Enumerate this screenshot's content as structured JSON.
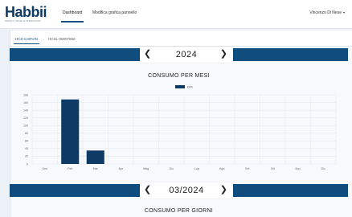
{
  "header": {
    "logo_text": "Habbii",
    "logo_tagline": "SMART HOME EXPERIENCE",
    "nav": [
      {
        "label": "Dashboard"
      },
      {
        "label": "Modifica grafica pannello"
      }
    ],
    "user_name": "Vincenzo Di Nese",
    "user_caret": "▾"
  },
  "tabs": [
    {
      "label": "HCS-CARVIN"
    },
    {
      "label": "HCSL-00007560"
    }
  ],
  "year_selector": {
    "label": "2024",
    "prev": "❮",
    "next": "❯"
  },
  "month_selector": {
    "label": "03/2024",
    "prev": "❮",
    "next": "❯"
  },
  "colors": {
    "bar": "#0e3a66",
    "band": "#0e4d7d"
  },
  "chart_data": {
    "type": "bar",
    "title": "CONSUMO PER MESI",
    "categories": [
      "Gen",
      "Feb",
      "Mar",
      "Apr",
      "Mag",
      "Giu",
      "Lug",
      "Ago",
      "Set",
      "Ott",
      "Nov",
      "Dic"
    ],
    "series": [
      {
        "name": "kWh",
        "values": [
          0,
          168,
          35,
          0,
          0,
          0,
          0,
          0,
          0,
          0,
          0,
          0
        ]
      }
    ],
    "y_ticks": [
      0,
      20,
      40,
      60,
      80,
      100,
      120,
      140,
      160,
      180
    ],
    "ylim": [
      0,
      180
    ],
    "grid": true,
    "legend": "top-center"
  },
  "second_chart_title": "CONSUMO PER GIORNI"
}
